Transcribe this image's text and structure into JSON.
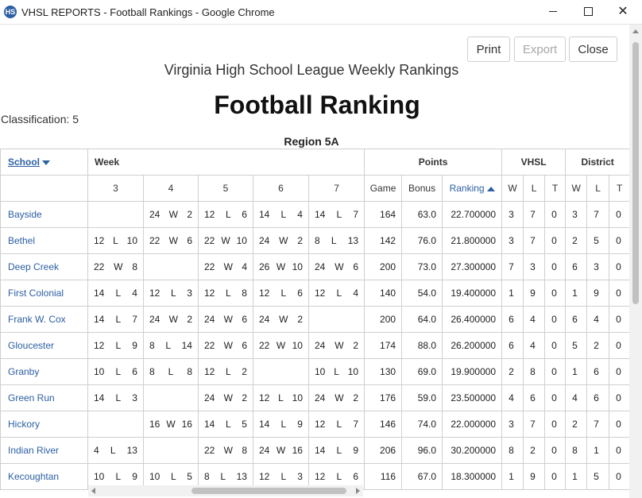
{
  "window": {
    "icon_text": "HS",
    "title": "VHSL REPORTS - Football Rankings - Google Chrome",
    "minimize_icon": "minimize-icon",
    "maximize_icon": "maximize-icon",
    "close_icon": "close-icon",
    "close_glyph": "✕"
  },
  "toolbar": {
    "print": "Print",
    "export": "Export",
    "close": "Close"
  },
  "report": {
    "subtitle": "Virginia High School League Weekly Rankings",
    "title": "Football Ranking",
    "classification": "Classification: 5",
    "region": "Region 5A"
  },
  "table": {
    "header1": {
      "school": "School",
      "week": "Week",
      "points": "Points",
      "vhsl": "VHSL",
      "district": "District"
    },
    "header2": {
      "weeks": [
        "3",
        "4",
        "5",
        "6",
        "7"
      ],
      "game": "Game",
      "bonus": "Bonus",
      "ranking": "Ranking",
      "w": "W",
      "l": "L",
      "t": "T"
    },
    "rows": [
      {
        "school": "Bayside",
        "weeks": [
          [
            "",
            "",
            ""
          ],
          [
            "24",
            "W",
            "2"
          ],
          [
            "12",
            "L",
            "6"
          ],
          [
            "14",
            "L",
            "4"
          ],
          [
            "14",
            "L",
            "7"
          ]
        ],
        "game": "164",
        "bonus": "63.0",
        "ranking": "22.700000",
        "vw": "3",
        "vl": "7",
        "vt": "0",
        "dw": "3",
        "dl": "7",
        "dt": "0"
      },
      {
        "school": "Bethel",
        "weeks": [
          [
            "12",
            "L",
            "10"
          ],
          [
            "22",
            "W",
            "6"
          ],
          [
            "22",
            "W",
            "10"
          ],
          [
            "24",
            "W",
            "2"
          ],
          [
            "8",
            "L",
            "13"
          ]
        ],
        "game": "142",
        "bonus": "76.0",
        "ranking": "21.800000",
        "vw": "3",
        "vl": "7",
        "vt": "0",
        "dw": "2",
        "dl": "5",
        "dt": "0"
      },
      {
        "school": "Deep Creek",
        "weeks": [
          [
            "22",
            "W",
            "8"
          ],
          [
            "",
            "",
            ""
          ],
          [
            "22",
            "W",
            "4"
          ],
          [
            "26",
            "W",
            "10"
          ],
          [
            "24",
            "W",
            "6"
          ]
        ],
        "game": "200",
        "bonus": "73.0",
        "ranking": "27.300000",
        "vw": "7",
        "vl": "3",
        "vt": "0",
        "dw": "6",
        "dl": "3",
        "dt": "0"
      },
      {
        "school": "First Colonial",
        "weeks": [
          [
            "14",
            "L",
            "4"
          ],
          [
            "12",
            "L",
            "3"
          ],
          [
            "12",
            "L",
            "8"
          ],
          [
            "12",
            "L",
            "6"
          ],
          [
            "12",
            "L",
            "4"
          ]
        ],
        "game": "140",
        "bonus": "54.0",
        "ranking": "19.400000",
        "vw": "1",
        "vl": "9",
        "vt": "0",
        "dw": "1",
        "dl": "9",
        "dt": "0"
      },
      {
        "school": "Frank W. Cox",
        "weeks": [
          [
            "14",
            "L",
            "7"
          ],
          [
            "24",
            "W",
            "2"
          ],
          [
            "24",
            "W",
            "6"
          ],
          [
            "24",
            "W",
            "2"
          ],
          [
            "",
            "",
            ""
          ]
        ],
        "game": "200",
        "bonus": "64.0",
        "ranking": "26.400000",
        "vw": "6",
        "vl": "4",
        "vt": "0",
        "dw": "6",
        "dl": "4",
        "dt": "0"
      },
      {
        "school": "Gloucester",
        "weeks": [
          [
            "12",
            "L",
            "9"
          ],
          [
            "8",
            "L",
            "14"
          ],
          [
            "22",
            "W",
            "6"
          ],
          [
            "22",
            "W",
            "10"
          ],
          [
            "24",
            "W",
            "2"
          ]
        ],
        "game": "174",
        "bonus": "88.0",
        "ranking": "26.200000",
        "vw": "6",
        "vl": "4",
        "vt": "0",
        "dw": "5",
        "dl": "2",
        "dt": "0"
      },
      {
        "school": "Granby",
        "weeks": [
          [
            "10",
            "L",
            "6"
          ],
          [
            "8",
            "L",
            "8"
          ],
          [
            "12",
            "L",
            "2"
          ],
          [
            "",
            "",
            ""
          ],
          [
            "10",
            "L",
            "10"
          ]
        ],
        "game": "130",
        "bonus": "69.0",
        "ranking": "19.900000",
        "vw": "2",
        "vl": "8",
        "vt": "0",
        "dw": "1",
        "dl": "6",
        "dt": "0"
      },
      {
        "school": "Green Run",
        "weeks": [
          [
            "14",
            "L",
            "3"
          ],
          [
            "",
            "",
            ""
          ],
          [
            "24",
            "W",
            "2"
          ],
          [
            "12",
            "L",
            "10"
          ],
          [
            "24",
            "W",
            "2"
          ]
        ],
        "game": "176",
        "bonus": "59.0",
        "ranking": "23.500000",
        "vw": "4",
        "vl": "6",
        "vt": "0",
        "dw": "4",
        "dl": "6",
        "dt": "0"
      },
      {
        "school": "Hickory",
        "weeks": [
          [
            "",
            "",
            ""
          ],
          [
            "16",
            "W",
            "16"
          ],
          [
            "14",
            "L",
            "5"
          ],
          [
            "14",
            "L",
            "9"
          ],
          [
            "12",
            "L",
            "7"
          ]
        ],
        "game": "146",
        "bonus": "74.0",
        "ranking": "22.000000",
        "vw": "3",
        "vl": "7",
        "vt": "0",
        "dw": "2",
        "dl": "7",
        "dt": "0"
      },
      {
        "school": "Indian River",
        "weeks": [
          [
            "4",
            "L",
            "13"
          ],
          [
            "",
            "",
            ""
          ],
          [
            "22",
            "W",
            "8"
          ],
          [
            "24",
            "W",
            "16"
          ],
          [
            "14",
            "L",
            "9"
          ]
        ],
        "game": "206",
        "bonus": "96.0",
        "ranking": "30.200000",
        "vw": "8",
        "vl": "2",
        "vt": "0",
        "dw": "8",
        "dl": "1",
        "dt": "0"
      },
      {
        "school": "Kecoughtan",
        "weeks": [
          [
            "10",
            "L",
            "9"
          ],
          [
            "10",
            "L",
            "5"
          ],
          [
            "8",
            "L",
            "13"
          ],
          [
            "12",
            "L",
            "3"
          ],
          [
            "12",
            "L",
            "6"
          ]
        ],
        "game": "116",
        "bonus": "67.0",
        "ranking": "18.300000",
        "vw": "1",
        "vl": "9",
        "vt": "0",
        "dw": "1",
        "dl": "5",
        "dt": "0"
      }
    ]
  }
}
